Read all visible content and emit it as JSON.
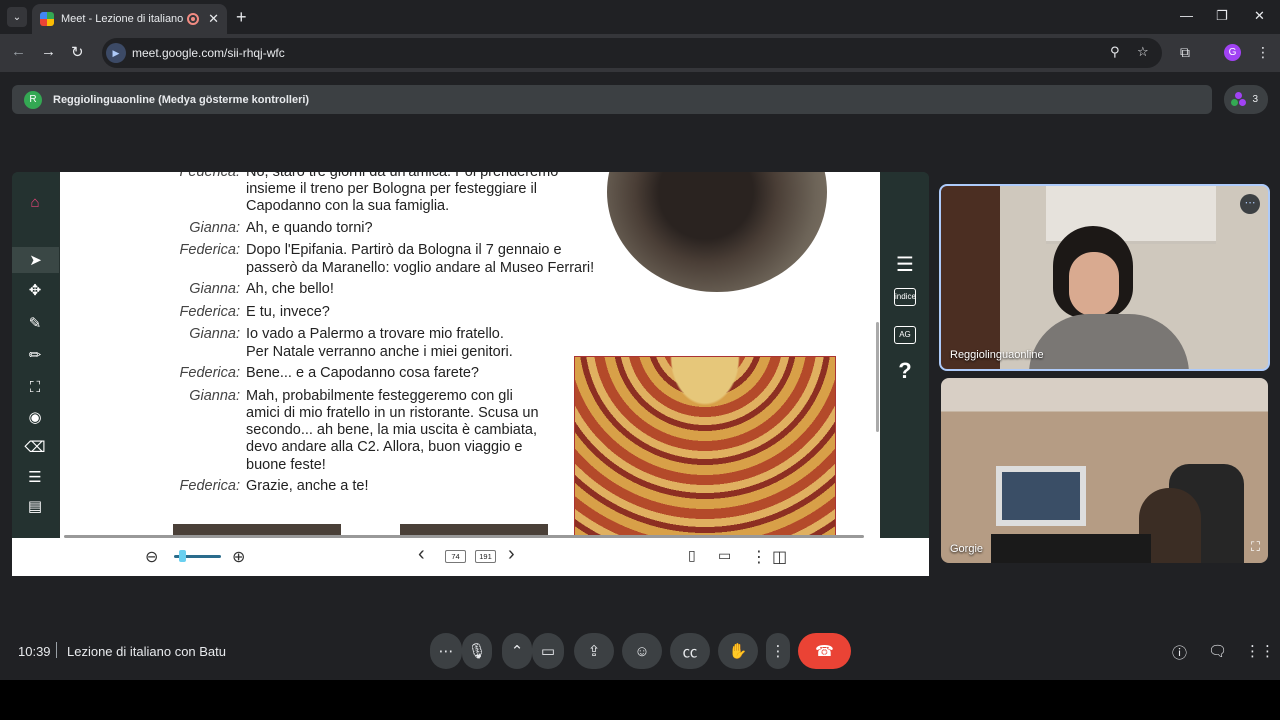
{
  "browser": {
    "tab_title": "Meet - Lezione di italiano con Batu",
    "url": "meet.google.com/sii-rhqj-wfc",
    "profile_initial": "G",
    "new_tab": "+",
    "tab_close": "✕"
  },
  "meet": {
    "presenter_avatar": "R",
    "presenter_banner": "Reggiolinguaonline (Medya gösterme kontrolleri)",
    "participants_count": "3",
    "time": "10:39",
    "meeting_title": "Lezione di italiano con Batu"
  },
  "tiles": [
    {
      "name": "Reggiolinguaonline"
    },
    {
      "name": "Gorgie"
    }
  ],
  "ebook": {
    "dialogue": [
      {
        "speaker": "Federica:",
        "lines": [
          "No, starò tre giorni da un'amica. Poi prenderemo",
          "insieme il treno per Bologna per festeggiare il",
          "Capodanno con la sua famiglia."
        ]
      },
      {
        "speaker": "Gianna:",
        "lines": [
          "Ah, e quando torni?"
        ]
      },
      {
        "speaker": "Federica:",
        "lines": [
          "Dopo l'Epifania. Partirò da Bologna il 7 gennaio e",
          "passerò da Maranello: voglio andare al Museo Ferrari!"
        ]
      },
      {
        "speaker": "Gianna:",
        "lines": [
          "Ah, che bello!"
        ]
      },
      {
        "speaker": "Federica:",
        "lines": [
          "E tu, invece?"
        ]
      },
      {
        "speaker": "Gianna:",
        "lines": [
          "Io vado a Palermo a trovare mio fratello.",
          "Per Natale verranno anche i miei genitori."
        ]
      },
      {
        "speaker": "Federica:",
        "lines": [
          "Bene... e a Capodanno cosa farete?"
        ]
      },
      {
        "speaker": "Gianna:",
        "lines": [
          "Mah, probabilmente festeggeremo con gli",
          "amici di mio fratello in un ristorante. Scusa un",
          "secondo... ah bene, la mia uscita è cambiata,",
          "devo andare alla C2. Allora, buon viaggio e",
          "buone feste!"
        ]
      },
      {
        "speaker": "Federica:",
        "lines": [
          "Grazie, anche a te!"
        ]
      }
    ],
    "page_current": "74",
    "page_total": "191",
    "right_tools": {
      "index_label": "indice",
      "ag_label": "AG",
      "help_label": "?"
    },
    "icons": [
      "home-icon",
      "pointer-icon",
      "move-icon",
      "pen-icon",
      "pencil-icon",
      "crop-icon",
      "eye-icon",
      "eraser-icon",
      "notes-icon",
      "list-icon"
    ]
  },
  "colors": {
    "accent": "#aecbfa",
    "hangup": "#ea4335",
    "presenter_avatar": "#34a853",
    "profile": "#a142f4"
  }
}
